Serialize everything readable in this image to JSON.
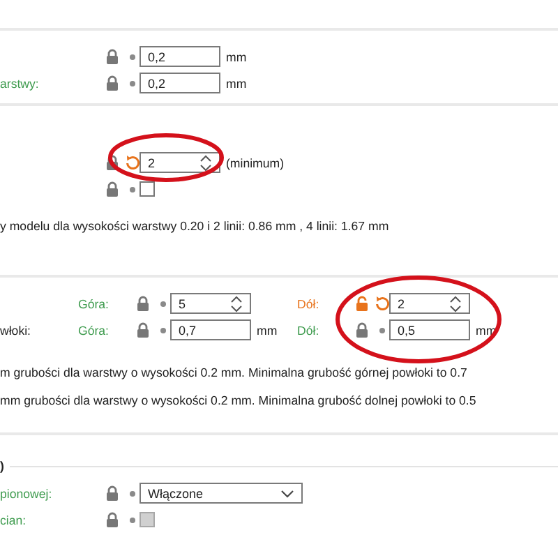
{
  "sections": [
    {
      "rows": [
        {
          "controls": [
            {
              "kind": "field",
              "locked": true,
              "modified": false,
              "value": "0,2",
              "unit": "mm"
            }
          ]
        },
        {
          "label": {
            "text": "arstwy:",
            "simple": true,
            "modified": false
          },
          "controls": [
            {
              "kind": "field",
              "locked": true,
              "modified": false,
              "value": "0,2",
              "unit": "mm"
            }
          ]
        }
      ]
    },
    {
      "rows": [
        {
          "controls": [
            {
              "kind": "spinner",
              "locked": true,
              "modified": true,
              "value": "2",
              "unit": "(minimum)"
            }
          ]
        },
        {
          "controls": [
            {
              "kind": "checkbox",
              "locked": true,
              "modified": false,
              "checked": false,
              "disabled": false
            }
          ]
        }
      ],
      "notes": [
        "y modelu dla wysokości warstwy 0.20 i 2 linii: 0.86 mm , 4 linii: 1.67 mm"
      ]
    },
    {
      "rows": [
        {
          "controls": [
            {
              "sublabel": {
                "text": "Góra:",
                "simple": true,
                "modified": false
              },
              "kind": "spinner",
              "locked": true,
              "modified": false,
              "value": "5"
            },
            {
              "sublabel": {
                "text": "Dół:",
                "modified": true
              },
              "kind": "spinner",
              "locked": false,
              "modified": true,
              "value": "2"
            }
          ]
        },
        {
          "label": {
            "text": "włoki:",
            "simple": false,
            "modified": false
          },
          "controls": [
            {
              "sublabel": {
                "text": "Góra:",
                "simple": true,
                "modified": false
              },
              "kind": "field",
              "locked": true,
              "modified": false,
              "value": "0,7",
              "unit": "mm"
            },
            {
              "sublabel": {
                "text": "Dół:",
                "simple": true,
                "modified": false
              },
              "kind": "field",
              "locked": true,
              "modified": false,
              "value": "0,5",
              "unit": "mm"
            }
          ]
        }
      ],
      "notes": [
        "m grubości dla warstwy o wysokości 0.2 mm. Minimalna grubość górnej powłoki to 0.7",
        "mm grubości dla warstwy o wysokości 0.2 mm. Minimalna grubość dolnej powłoki to 0.5"
      ]
    },
    {
      "legend": ")",
      "rows": [
        {
          "label": {
            "text": "pionowej:",
            "simple": true,
            "modified": false
          },
          "controls": [
            {
              "kind": "dropdown",
              "locked": true,
              "modified": false,
              "value": "Włączone"
            }
          ]
        },
        {
          "label": {
            "text": "cian:",
            "simple": true,
            "modified": false
          },
          "controls": [
            {
              "kind": "checkbox",
              "locked": true,
              "modified": false,
              "checked": false,
              "disabled": true
            }
          ]
        }
      ]
    }
  ],
  "annotations": [
    {
      "kind": "ellipse"
    },
    {
      "kind": "ellipse"
    }
  ]
}
